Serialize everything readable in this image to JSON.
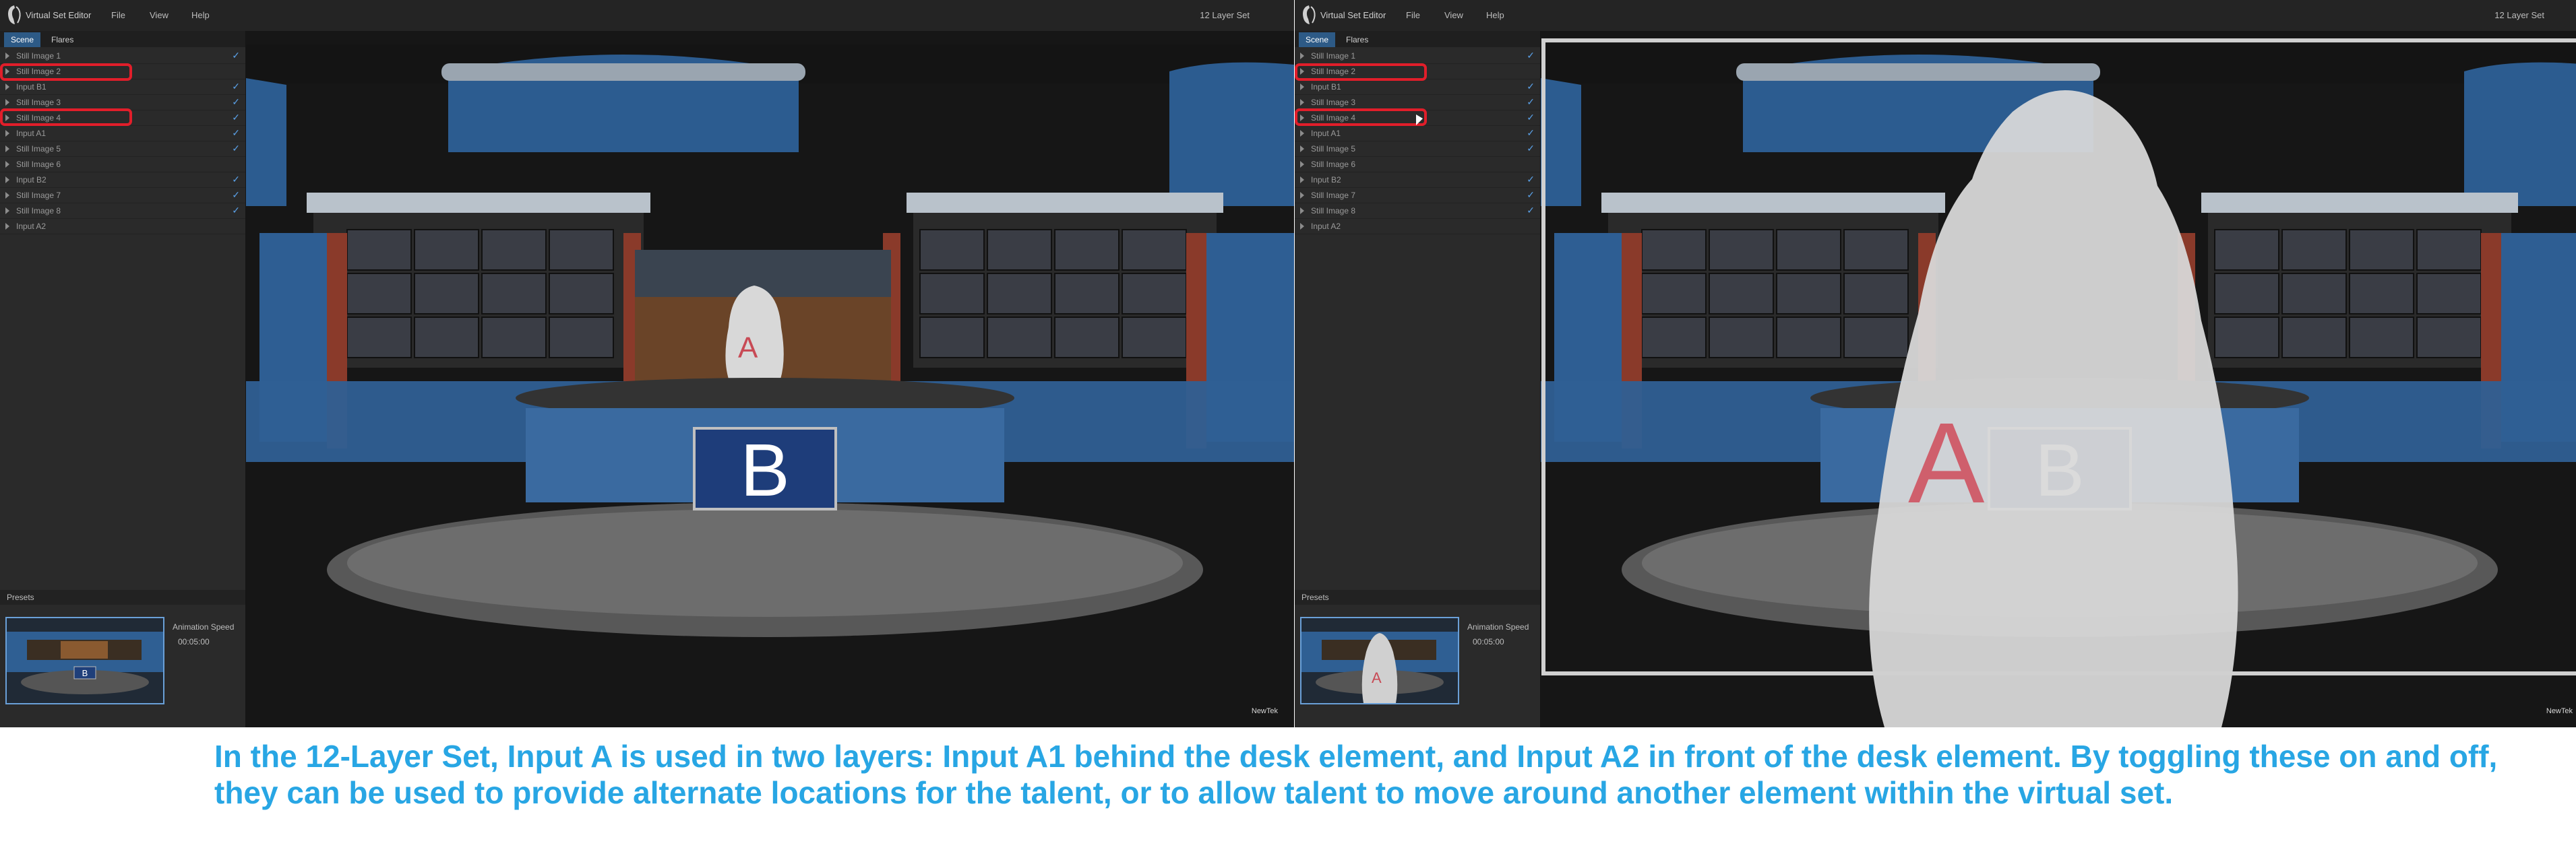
{
  "app": {
    "title": "Virtual Set Editor",
    "menu": [
      "File",
      "View",
      "Help"
    ],
    "set_name": "12 Layer Set",
    "tabs": [
      "Scene",
      "Flares"
    ]
  },
  "layers": [
    {
      "label": "Still Image 1",
      "checked": true
    },
    {
      "label": "Still Image 2",
      "checked": false
    },
    {
      "label": "Input B1",
      "checked": true
    },
    {
      "label": "Still Image 3",
      "checked": true
    },
    {
      "label": "Still Image 4",
      "checked": true
    },
    {
      "label": "Input A1",
      "checked": true
    },
    {
      "label": "Still Image 5",
      "checked": true
    },
    {
      "label": "Still Image 6",
      "checked": false
    },
    {
      "label": "Input B2",
      "checked": true
    },
    {
      "label": "Still Image 7",
      "checked": true
    },
    {
      "label": "Still Image 8",
      "checked": true
    },
    {
      "label": "Input A2",
      "checked": false
    }
  ],
  "presets": {
    "label": "Presets",
    "animation_speed_label": "Animation Speed",
    "animation_speed_value": "00:05:00"
  },
  "scene": {
    "desk_label": "B",
    "talent_label": "A",
    "watermark": "NewTek"
  },
  "caption": "In the 12-Layer Set, Input A is used in two layers: Input A1 behind the desk element, and Input A2 in front of the desk element. By toggling these on and off, they can be used to provide alternate locations for the talent, or to allow talent to move around another element within the virtual set.",
  "colors": {
    "accent_blue": "#2d5a86",
    "highlight_red": "#e11e2a",
    "caption_blue": "#28a6e4"
  }
}
